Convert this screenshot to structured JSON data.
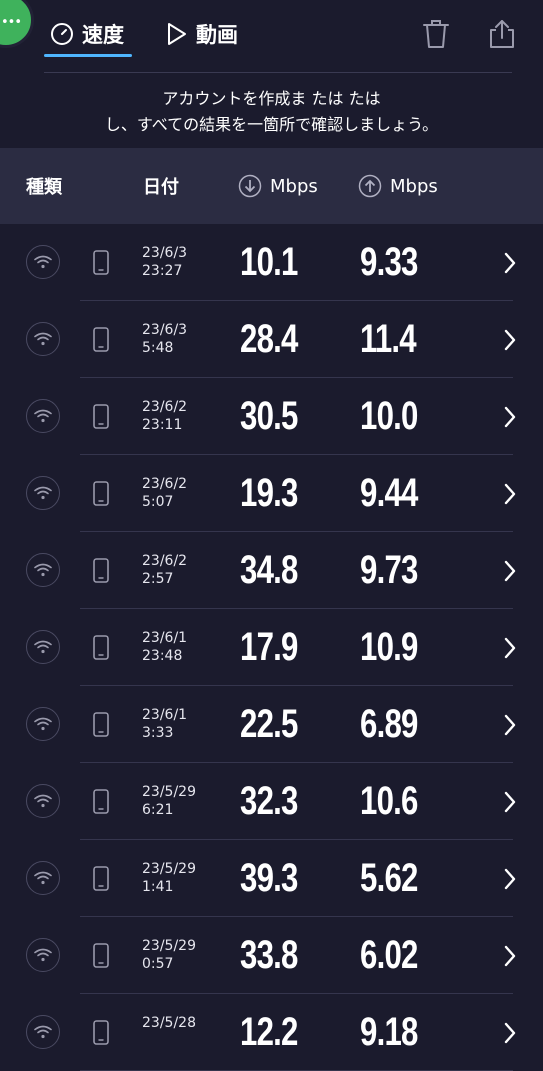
{
  "tabs": {
    "speed_label": "速度",
    "video_label": "動画"
  },
  "promo": {
    "line1": "アカウントを作成ま たは たは",
    "line2": "し、すべての結果を一箇所で確認しましょう。"
  },
  "columns": {
    "type": "種類",
    "date": "日付",
    "download": "Mbps",
    "upload": "Mbps"
  },
  "colors": {
    "background": "#1b1b2d",
    "header_bg": "#2b2c42",
    "accent": "#4fb6ff",
    "avatar": "#3fb25c"
  },
  "results": [
    {
      "date": "23/6/3",
      "time": "23:27",
      "down": "10.1",
      "up": "9.33"
    },
    {
      "date": "23/6/3",
      "time": "5:48",
      "down": "28.4",
      "up": "11.4"
    },
    {
      "date": "23/6/2",
      "time": "23:11",
      "down": "30.5",
      "up": "10.0"
    },
    {
      "date": "23/6/2",
      "time": "5:07",
      "down": "19.3",
      "up": "9.44"
    },
    {
      "date": "23/6/2",
      "time": "2:57",
      "down": "34.8",
      "up": "9.73"
    },
    {
      "date": "23/6/1",
      "time": "23:48",
      "down": "17.9",
      "up": "10.9"
    },
    {
      "date": "23/6/1",
      "time": "3:33",
      "down": "22.5",
      "up": "6.89"
    },
    {
      "date": "23/5/29",
      "time": "6:21",
      "down": "32.3",
      "up": "10.6"
    },
    {
      "date": "23/5/29",
      "time": "1:41",
      "down": "39.3",
      "up": "5.62"
    },
    {
      "date": "23/5/29",
      "time": "0:57",
      "down": "33.8",
      "up": "6.02"
    },
    {
      "date": "23/5/28",
      "time": "",
      "down": "12.2",
      "up": "9.18"
    }
  ]
}
